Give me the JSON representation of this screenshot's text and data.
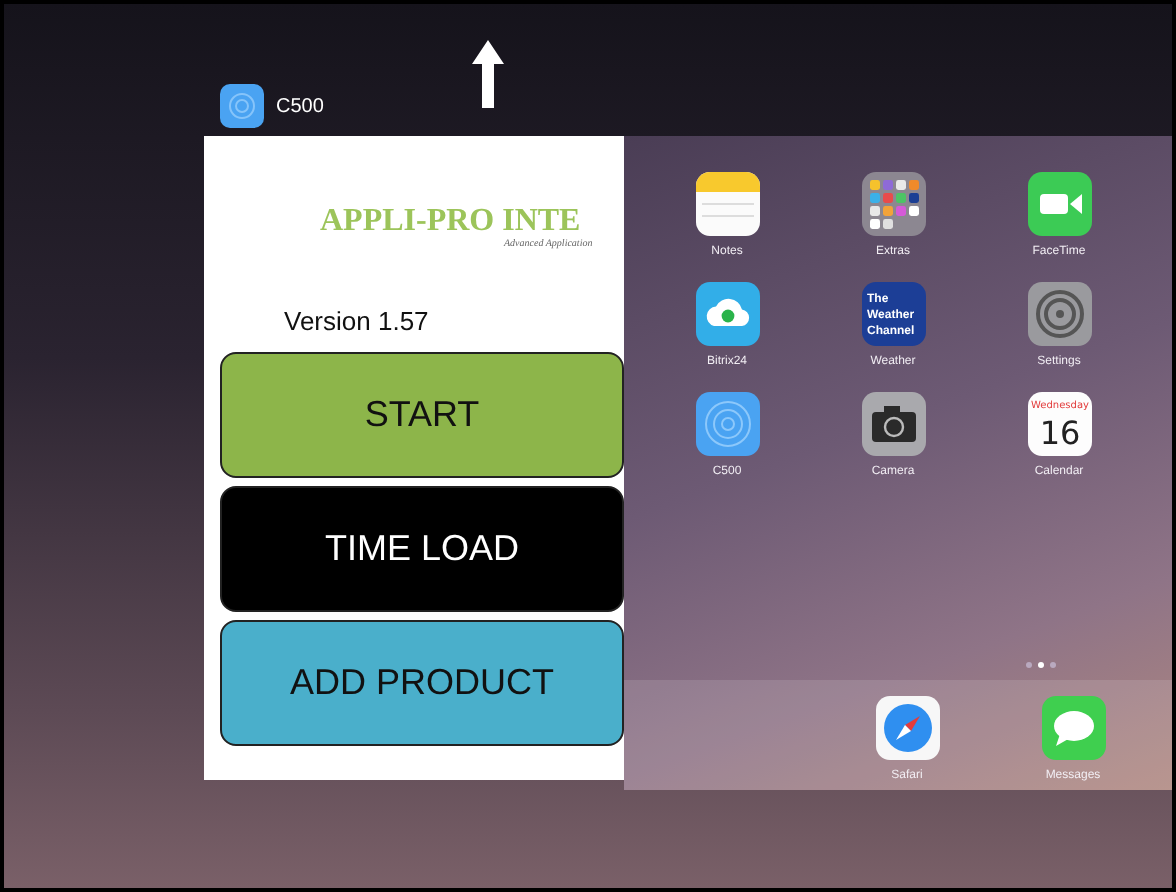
{
  "app_label": {
    "name": "C500"
  },
  "app_card": {
    "title": "APPLI-PRO INTE",
    "subtitle": "Advanced Application",
    "version": "Version 1.57",
    "buttons": [
      {
        "label": "START",
        "color": "#8db54a"
      },
      {
        "label": "TIME LOAD",
        "color": "#000000"
      },
      {
        "label": "ADD PRODUCT",
        "color": "#4aafcb"
      }
    ]
  },
  "home_screen": {
    "apps": [
      {
        "label": "Notes",
        "kind": "notes"
      },
      {
        "label": "Extras",
        "kind": "folder"
      },
      {
        "label": "FaceTime",
        "kind": "facetime"
      },
      {
        "label": "Bitrix24",
        "kind": "cloud"
      },
      {
        "label": "Weather",
        "kind": "weather",
        "icon_lines": [
          "The",
          "Weather",
          "Channel"
        ]
      },
      {
        "label": "Settings",
        "kind": "settings"
      },
      {
        "label": "C500",
        "kind": "target"
      },
      {
        "label": "Camera",
        "kind": "camera"
      },
      {
        "label": "Calendar",
        "kind": "calendar",
        "day": "Wednesday",
        "date": "16"
      }
    ],
    "page_dots": [
      {
        "selected": false
      },
      {
        "selected": true
      },
      {
        "selected": false
      }
    ],
    "dock": [
      {
        "label": "Safari",
        "kind": "compass"
      },
      {
        "label": "Messages",
        "kind": "messages"
      }
    ]
  }
}
